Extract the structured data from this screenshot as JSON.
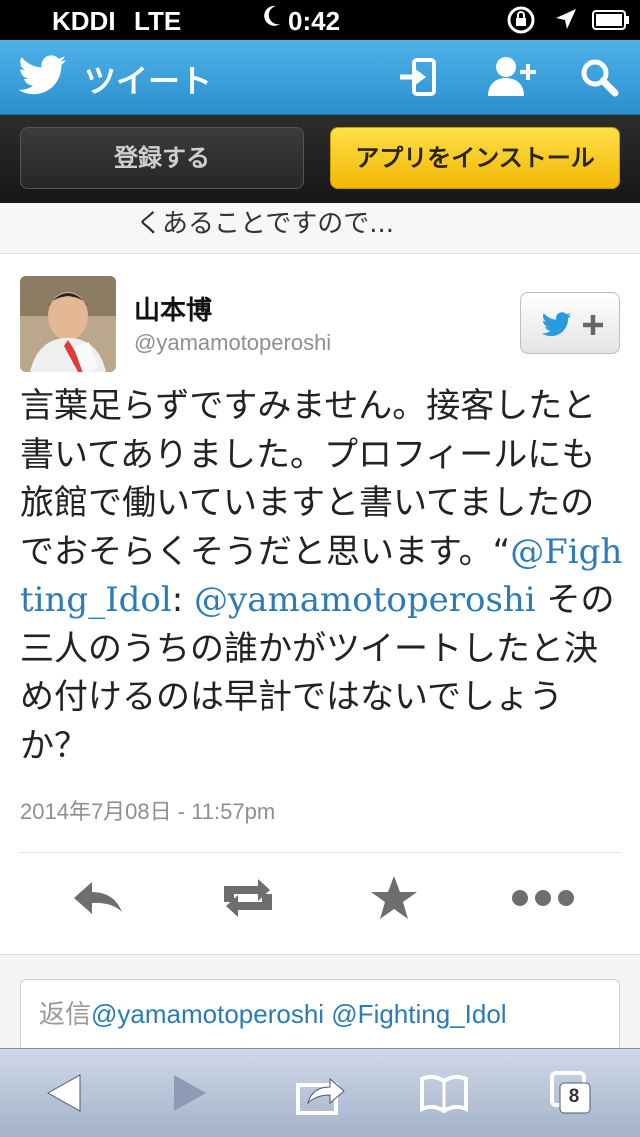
{
  "status_bar": {
    "carrier": "KDDI",
    "network": "LTE",
    "time": "0:42"
  },
  "header": {
    "title": "ツイート",
    "brand_color": "#3aa0dc"
  },
  "cta": {
    "register_label": "登録する",
    "install_label": "アプリをインストール"
  },
  "previous_tweet": {
    "tail_text": "くあることですので..."
  },
  "tweet": {
    "name": "山本博",
    "handle": "@yamamotoperoshi",
    "text_1": "言葉足らずですみません。接客したと書いてありました。プロフィールにも旅館で働いていますと書いてましたのでおそらくそうだと思います。“",
    "mention_1": "@Fighting_Idol",
    "text_2": ": ",
    "mention_2": "@yamamotoperoshi",
    "text_3": " その三人のうちの誰かがツイートしたと決め付けるのは早計ではないでしょうか？",
    "timestamp": "2014年7月08日 - 11:57pm"
  },
  "reply": {
    "prefix": "返信",
    "mentions": "@yamamotoperoshi @Fighting_Idol"
  },
  "safari": {
    "tab_count": "8"
  }
}
